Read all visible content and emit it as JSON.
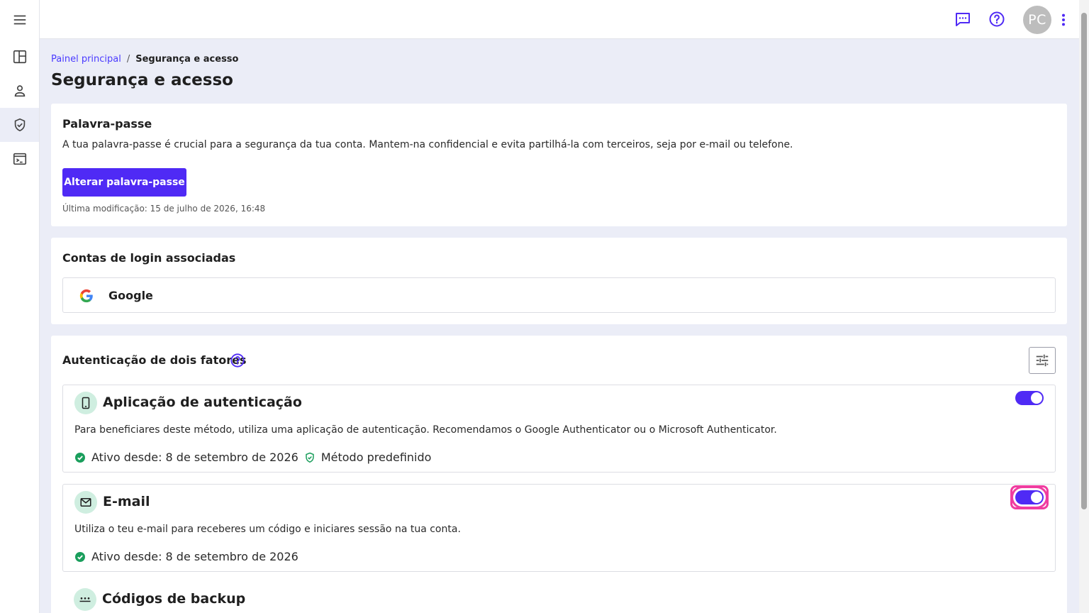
{
  "rail": {
    "items": [
      {
        "icon": "menu-icon"
      },
      {
        "icon": "dashboard-icon"
      },
      {
        "icon": "person-icon"
      },
      {
        "icon": "shield-check-icon",
        "active": true
      },
      {
        "icon": "terminal-icon"
      }
    ]
  },
  "header": {
    "avatar_initials": "PC"
  },
  "breadcrumb": {
    "home": "Painel principal",
    "separator": "/",
    "current": "Segurança e acesso"
  },
  "page": {
    "title": "Segurança e acesso"
  },
  "password": {
    "title": "Palavra-passe",
    "description": "A tua palavra-passe é crucial para a segurança da tua conta. Mantem-na confidencial e evita partilhá-la com terceiros, seja por e-mail ou telefone.",
    "button_label": "Alterar palavra-passe",
    "last_modified": "Última modificação: 15 de julho de 2026, 16:48"
  },
  "linked_accounts": {
    "title": "Contas de login associadas",
    "items": [
      {
        "name": "Google"
      }
    ]
  },
  "two_factor": {
    "title": "Autenticação de dois fatores",
    "methods": [
      {
        "title": "Aplicação de autenticação",
        "description": "Para beneficiares deste método, utiliza uma aplicação de autenticação. Recomendamos o Google Authenticator ou o Microsoft Authenticator.",
        "status": "Ativo desde: 8 de setembro de 2026",
        "default_label": "Método predefinido",
        "enabled": true
      },
      {
        "title": "E-mail",
        "description": "Utiliza o teu e-mail para receberes um código e iniciares sessão na tua conta.",
        "status": "Ativo desde: 8 de setembro de 2026",
        "enabled": true
      },
      {
        "title": "Códigos de backup"
      }
    ]
  },
  "colors": {
    "primary": "#4f2af5",
    "link": "#4a3aff",
    "success": "#1a9e5c",
    "focus_ring": "#f03ca0",
    "background": "#ebedf7"
  }
}
